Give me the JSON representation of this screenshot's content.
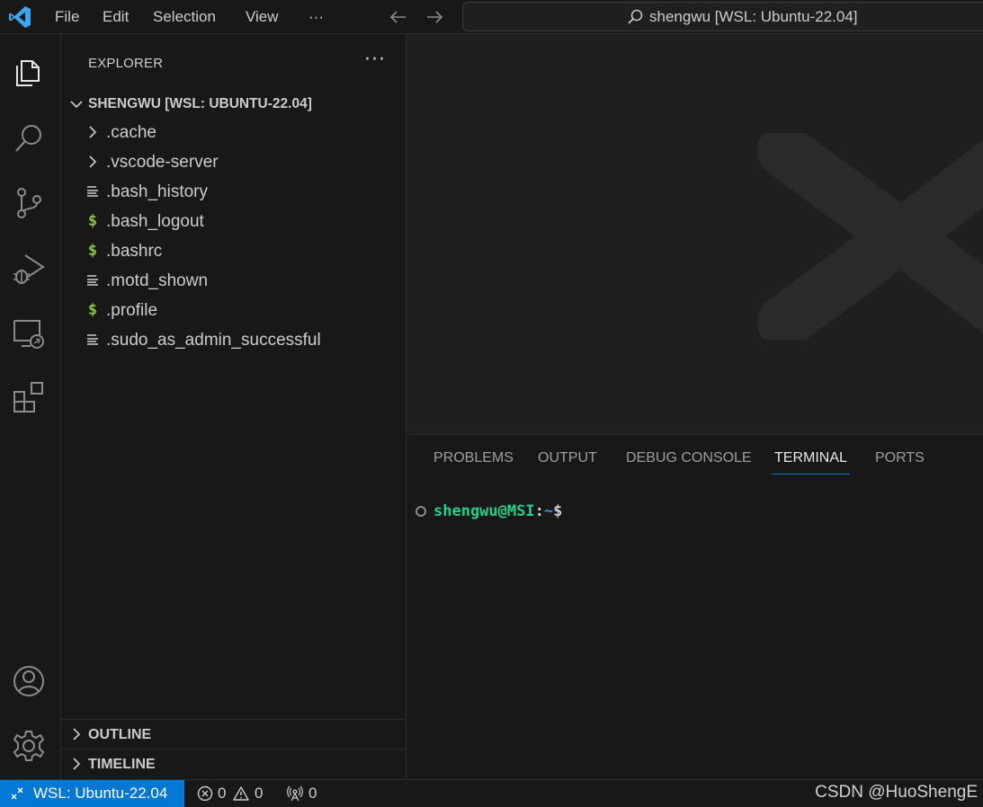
{
  "titlebar": {
    "menu": [
      "File",
      "Edit",
      "Selection",
      "View",
      "···"
    ],
    "command_center": "shengwu [WSL: Ubuntu-22.04]"
  },
  "activitybar": {
    "items": [
      "explorer-icon",
      "search-icon",
      "source-control-icon",
      "run-debug-icon",
      "remote-explorer-icon",
      "extensions-icon"
    ],
    "bottom": [
      "accounts-icon",
      "manage-gear-icon"
    ]
  },
  "sidebar": {
    "title": "EXPLORER",
    "more": "···",
    "folder": "SHENGWU [WSL: UBUNTU-22.04]",
    "items": [
      {
        "name": ".cache",
        "kind": "folder"
      },
      {
        "name": ".vscode-server",
        "kind": "folder"
      },
      {
        "name": ".bash_history",
        "kind": "text"
      },
      {
        "name": ".bash_logout",
        "kind": "shell"
      },
      {
        "name": ".bashrc",
        "kind": "shell"
      },
      {
        "name": ".motd_shown",
        "kind": "text"
      },
      {
        "name": ".profile",
        "kind": "shell"
      },
      {
        "name": ".sudo_as_admin_successful",
        "kind": "text"
      }
    ],
    "sections": [
      "OUTLINE",
      "TIMELINE"
    ],
    "shell_glyph": "$"
  },
  "panel": {
    "tabs": [
      "PROBLEMS",
      "OUTPUT",
      "DEBUG CONSOLE",
      "TERMINAL",
      "PORTS"
    ],
    "active_tab": "TERMINAL",
    "terminal": {
      "user": "shengwu@MSI",
      "sep": ":",
      "path": "~",
      "prompt": "$"
    }
  },
  "statusbar": {
    "remote": "WSL: Ubuntu-22.04",
    "errors": "0",
    "warnings": "0",
    "ports": "0",
    "credit": "CSDN @HuoShengE"
  },
  "colors": {
    "accent": "#0078d4",
    "terminal_user": "#23d18b",
    "terminal_path": "#3b8eea",
    "shell_icon": "#8dc149"
  }
}
